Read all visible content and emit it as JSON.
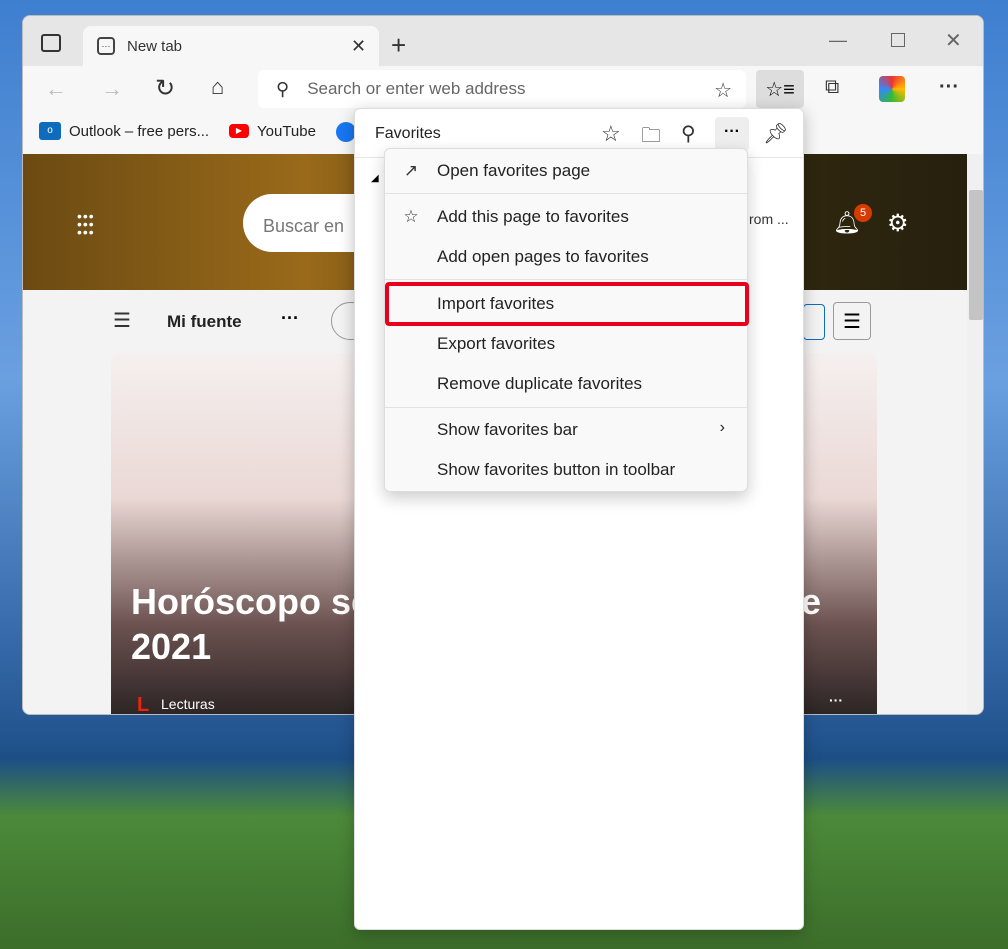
{
  "browser": {
    "tab_title": "New tab",
    "address_placeholder": "Search or enter web address",
    "bookmarks": [
      {
        "label": "Outlook – free pers..."
      },
      {
        "label": "YouTube"
      }
    ]
  },
  "newtab": {
    "search_placeholder": "Buscar en",
    "feed_title": "Mi fuente",
    "notification_count": "5",
    "partial_text": "rom ...",
    "card_title_line1": "Horóscopo se",
    "card_title_right": "e",
    "card_title_line2": "2021",
    "card_source": "Lecturas",
    "card_source_logo": "L"
  },
  "favorites": {
    "title": "Favorites",
    "menu": [
      {
        "label": "Open favorites page"
      },
      {
        "label": "Add this page to favorites"
      },
      {
        "label": "Add open pages to favorites"
      },
      {
        "label": "Import favorites"
      },
      {
        "label": "Export favorites"
      },
      {
        "label": "Remove duplicate favorites"
      },
      {
        "label": "Show favorites bar"
      },
      {
        "label": "Show favorites button in toolbar"
      }
    ]
  },
  "colors": {
    "highlight": "#e8001c"
  }
}
